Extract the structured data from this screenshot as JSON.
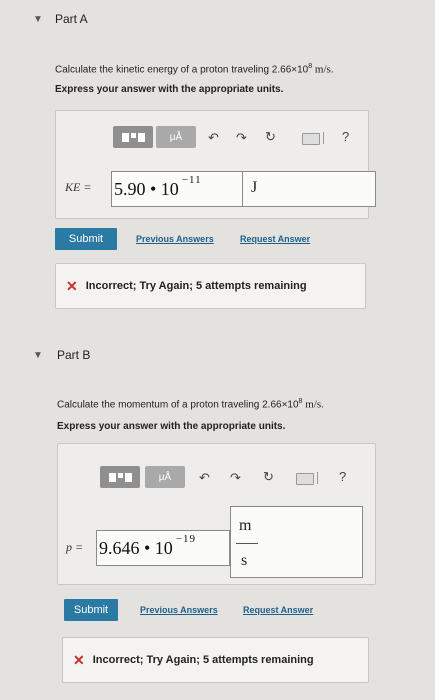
{
  "partA": {
    "caret": "▼",
    "title": "Part A",
    "question_text": "Calculate the kinetic energy of a proton traveling 2.66×10",
    "question_exp": "8",
    "question_unit": "m/s",
    "question_end": ".",
    "instruction": "Express your answer with the appropriate units.",
    "toolbar": {
      "units_label": "μÅ",
      "help": "?"
    },
    "answer": {
      "label": "KE =",
      "mantissa": "5.90 • 10",
      "exponent": "−11",
      "unit": "J"
    },
    "submit_label": "Submit",
    "previous_answers": "Previous Answers",
    "request_answer": "Request Answer",
    "feedback": {
      "icon": "✕",
      "text": "Incorrect; Try Again; 5 attempts remaining"
    }
  },
  "partB": {
    "caret": "▼",
    "title": "Part B",
    "question_text": "Calculate the momentum of a proton traveling 2.66×10",
    "question_exp": "8",
    "question_unit": "m/s",
    "question_end": ".",
    "instruction": "Express your answer with the appropriate units.",
    "toolbar": {
      "units_label": "μÅ",
      "help": "?"
    },
    "answer": {
      "label": "p =",
      "mantissa": "9.646 • 10",
      "exponent": "−19",
      "unit_num": "m",
      "unit_den": "s"
    },
    "submit_label": "Submit",
    "previous_answers": "Previous Answers",
    "request_answer": "Request Answer",
    "feedback": {
      "icon": "✕",
      "text": "Incorrect; Try Again; 5 attempts remaining"
    }
  }
}
